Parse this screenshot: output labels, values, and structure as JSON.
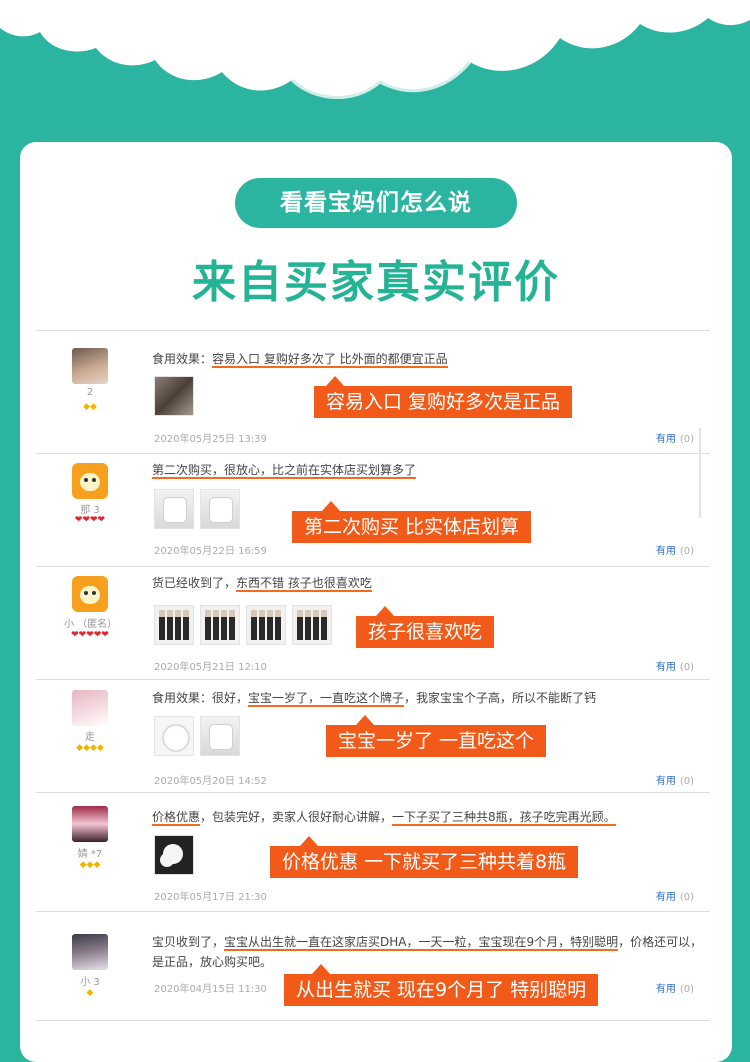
{
  "colors": {
    "teal": "#2bb4a0",
    "headline_green": "#25b395",
    "orange": "#f25a19",
    "link_blue": "#2a6fc6"
  },
  "header": {
    "pill": "看看宝妈们怎么说",
    "headline": "来自买家真实评价"
  },
  "reviews": [
    {
      "user": "2",
      "level": "◆◆",
      "level_color": "gold",
      "text_prefix": "食用效果：",
      "text_highlight": "容易入口 复购好多次了 比外面的都便宜正品",
      "text_suffix": "",
      "callout": "容易入口 复购好多次是正品",
      "date": "2020年05月25日 13:39",
      "useful_label": "有用",
      "useful_count": "(0)"
    },
    {
      "user": "那     3",
      "level": "❤❤❤❤",
      "level_color": "red",
      "text_prefix": "",
      "text_highlight": "第二次购买，很放心，比之前在实体店买划算多了",
      "text_suffix": "",
      "callout": "第二次购买 比实体店划算",
      "date": "2020年05月22日 16:59",
      "useful_label": "有用",
      "useful_count": "(0)"
    },
    {
      "user": "小     （匿名）",
      "level": "❤❤❤❤❤",
      "level_color": "red",
      "text_prefix": "货已经收到了，",
      "text_highlight": "东西不错 孩子也很喜欢吃",
      "text_suffix": "",
      "callout": "孩子很喜欢吃",
      "date": "2020年05月21日 12:10",
      "useful_label": "有用",
      "useful_count": "(0)"
    },
    {
      "user": "走     ",
      "level": "◆◆◆◆",
      "level_color": "gold",
      "text_prefix": "食用效果：很好，",
      "text_highlight": "宝宝一岁了，一直吃这个牌子",
      "text_suffix": "，我家宝宝个子高，所以不能断了钙",
      "callout": "宝宝一岁了  一直吃这个",
      "date": "2020年05月20日 14:52",
      "useful_label": "有用",
      "useful_count": "(0)"
    },
    {
      "user": "婧     *7",
      "level": "◆◆◆",
      "level_color": "gold",
      "text_prefix": "",
      "text_highlight": "价格优惠",
      "text_suffix": "，包装完好，卖家人很好耐心讲解，",
      "text_highlight2": "一下子买了三种共8瓶，孩子吃完再光顾。",
      "callout": "价格优惠  一下就买了三种共着8瓶",
      "date": "2020年05月17日 21:30",
      "useful_label": "有用",
      "useful_count": "(0)"
    },
    {
      "user": "小     3",
      "level": "◆",
      "level_color": "gold",
      "text_prefix": "宝贝收到了，",
      "text_highlight": "宝宝从出生就一直在这家店买DHA，一天一粒，宝宝现在9个月，特别聪明",
      "text_suffix": "，价格还可以，是正品，放心购买吧。",
      "callout": "从出生就买 现在9个月了 特别聪明",
      "date": "2020年04月15日 11:30",
      "useful_label": "有用",
      "useful_count": "(0)"
    }
  ]
}
